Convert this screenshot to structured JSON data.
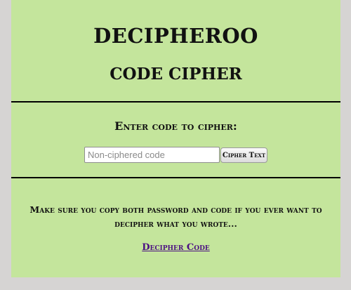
{
  "app": {
    "title": "DECIPHEROO",
    "heading": "CODE CIPHER"
  },
  "cipher_form": {
    "prompt": "Enter code to cipher:",
    "input_placeholder": "Non-ciphered code",
    "input_value": "",
    "button_label": "Cipher Text"
  },
  "footer": {
    "warning": "Make sure you copy both password and code if you ever want to decipher what you wrote...",
    "decipher_link": "Decipher Code"
  },
  "colors": {
    "background": "#d6d4d3",
    "panel": "#c4e59c",
    "link": "#4b0f82"
  }
}
